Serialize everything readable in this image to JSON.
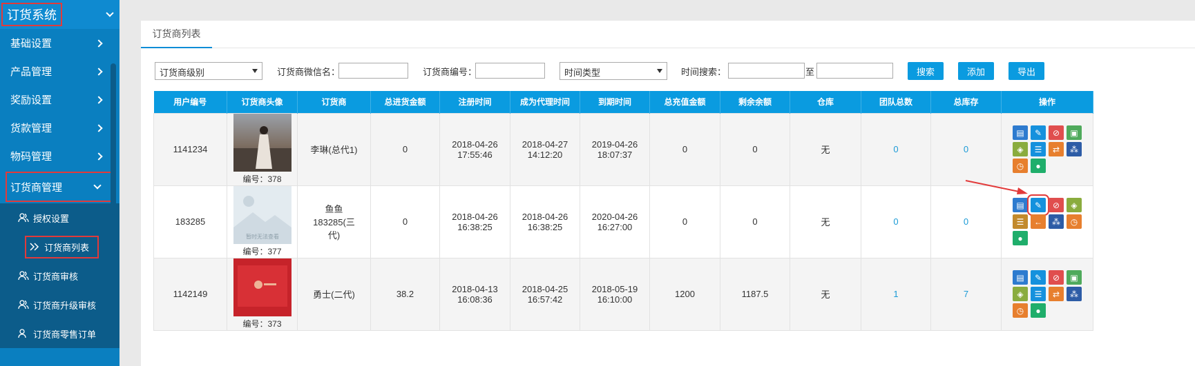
{
  "sidebar": {
    "title": "订货系统",
    "items": [
      {
        "label": "基础设置"
      },
      {
        "label": "产品管理"
      },
      {
        "label": "奖励设置"
      },
      {
        "label": "货款管理"
      },
      {
        "label": "物码管理"
      },
      {
        "label": "订货商管理"
      }
    ],
    "subitems": [
      {
        "label": "授权设置"
      },
      {
        "label": "订货商列表"
      },
      {
        "label": "订货商审核"
      },
      {
        "label": "订货商升级审核"
      },
      {
        "label": "订货商零售订单"
      }
    ]
  },
  "tab": {
    "label": "订货商列表"
  },
  "filters": {
    "level_select": "订货商级别",
    "wechat_label": "订货商微信名：",
    "code_label": "订货商编号：",
    "time_type_select": "时间类型",
    "time_search_label": "时间搜索：",
    "to_label": "至",
    "search_button": "搜索",
    "add_button": "添加",
    "export_button": "导出"
  },
  "table": {
    "columns": [
      "用户编号",
      "订货商头像",
      "订货商",
      "总进货金额",
      "注册时间",
      "成为代理时间",
      "到期时间",
      "总充值金额",
      "剩余余额",
      "仓库",
      "团队总数",
      "总库存",
      "操作"
    ],
    "rows": [
      {
        "user_id": "1141234",
        "avatar_caption": "编号：378",
        "name": "李琳(总代1)",
        "total_purchase": "0",
        "reg_date": "2018-04-26",
        "reg_time": "17:55:46",
        "agent_date": "2018-04-27",
        "agent_time": "14:12:20",
        "expire_date": "2019-04-26",
        "expire_time": "18:07:37",
        "total_recharge": "0",
        "balance": "0",
        "warehouse": "无",
        "team_total": "0",
        "total_stock": "0"
      },
      {
        "user_id": "183285",
        "avatar_caption": "编号：377",
        "avatar_placeholder": "暂时无法查看",
        "name_line1": "鱼鱼",
        "name_line2": "183285(三",
        "name_line3": "代)",
        "total_purchase": "0",
        "reg_date": "2018-04-26",
        "reg_time": "16:38:25",
        "agent_date": "2018-04-26",
        "agent_time": "16:38:25",
        "expire_date": "2020-04-26",
        "expire_time": "16:27:00",
        "total_recharge": "0",
        "balance": "0",
        "warehouse": "无",
        "team_total": "0",
        "total_stock": "0"
      },
      {
        "user_id": "1142149",
        "avatar_caption": "编号：373",
        "name": "勇士(二代)",
        "total_purchase": "38.2",
        "reg_date": "2018-04-13",
        "reg_time": "16:08:36",
        "agent_date": "2018-04-25",
        "agent_time": "16:57:42",
        "expire_date": "2018-05-19",
        "expire_time": "16:10:00",
        "total_recharge": "1200",
        "balance": "1187.5",
        "warehouse": "无",
        "team_total": "1",
        "total_stock": "7"
      }
    ]
  },
  "colors": {
    "sidebar": "#0a7fc0",
    "accent": "#0a9be0",
    "highlight": "#e23a3a"
  }
}
